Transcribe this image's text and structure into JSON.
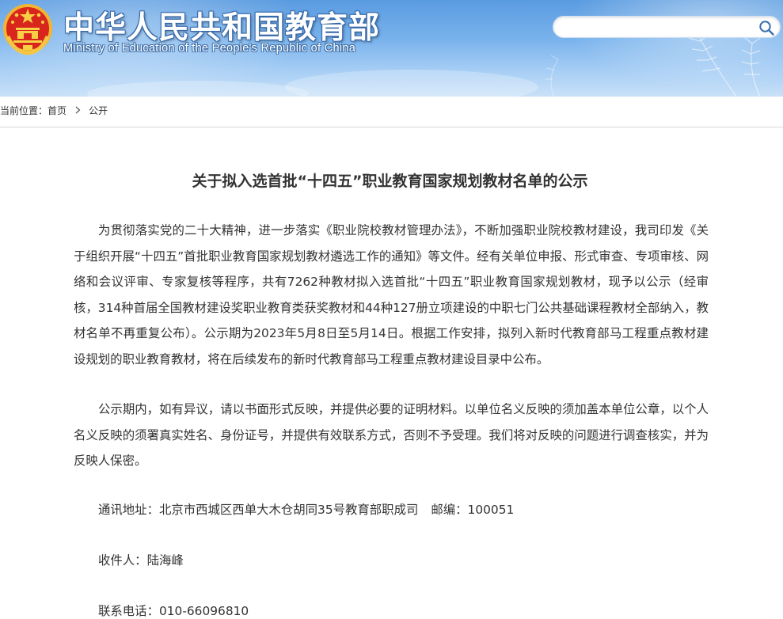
{
  "header": {
    "site_title_cn": "中华人民共和国教育部",
    "site_title_en": "Ministry of Education of the People's Republic of China",
    "emblem_icon": "national-emblem-icon",
    "search": {
      "placeholder": "",
      "value": "",
      "icon": "search-icon"
    },
    "colors": {
      "sky": "#6fa8e8",
      "emblem_red": "#d6261c",
      "emblem_gold": "#f5c543"
    }
  },
  "breadcrumb": {
    "label": "当前位置：",
    "items": [
      "首页",
      "公开"
    ],
    "separator_icon": "chevron-right-icon"
  },
  "article": {
    "title": "关于拟入选首批“十四五”职业教育国家规划教材名单的公示",
    "paragraphs": [
      "为贯彻落实党的二十大精神，进一步落实《职业院校教材管理办法》，不断加强职业院校教材建设，我司印发《关于组织开展“十四五”首批职业教育国家规划教材遴选工作的通知》等文件。经有关单位申报、形式审查、专项审核、网络和会议评审、专家复核等程序，共有7262种教材拟入选首批“十四五”职业教育国家规划教材，现予以公示（经审核，314种首届全国教材建设奖职业教育类获奖教材和44种127册立项建设的中职七门公共基础课程教材全部纳入，教材名单不再重复公布）。公示期为2023年5月8日至5月14日。根据工作安排，拟列入新时代教育部马工程重点教材建设规划的职业教育教材，将在后续发布的新时代教育部马工程重点教材建设目录中公布。",
      "公示期内，如有异议，请以书面形式反映，并提供必要的证明材料。以单位名义反映的须加盖本单位公章，以个人名义反映的须署真实姓名、身份证号，并提供有效联系方式，否则不予受理。我们将对反映的问题进行调查核实，并为反映人保密。"
    ],
    "contact": {
      "address": "通讯地址：北京市西城区西单大木仓胡同35号教育部职成司",
      "postcode": "邮编：100051",
      "recipient": "收件人：陆海峰",
      "phone": "联系电话：010-66096810"
    }
  }
}
